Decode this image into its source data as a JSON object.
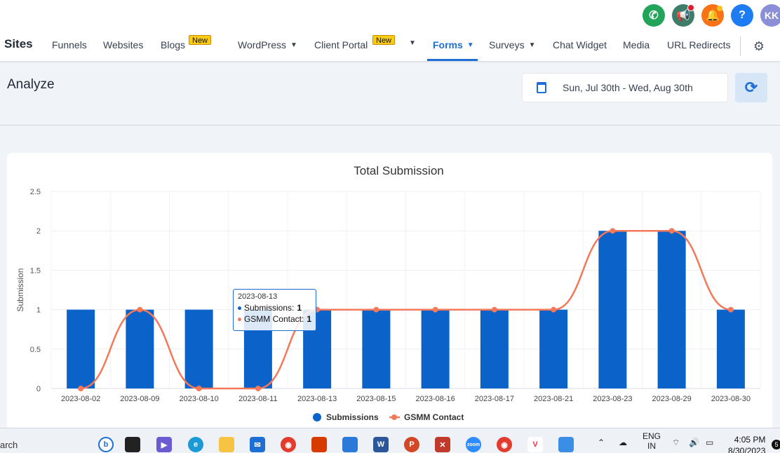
{
  "header_icons": {
    "phone": "phone-icon",
    "megaphone": "megaphone-icon",
    "bell": "bell-icon",
    "help": "help-icon",
    "avatar_initials": "KK"
  },
  "nav": {
    "brand": "Sites",
    "items": [
      {
        "label": "Funnels"
      },
      {
        "label": "Websites"
      },
      {
        "label": "Blogs",
        "badge": "New"
      },
      {
        "label": "WordPress"
      },
      {
        "label": "Client Portal",
        "badge": "New"
      },
      {
        "label": "Forms",
        "active": true
      },
      {
        "label": "Surveys"
      },
      {
        "label": "Chat Widget"
      },
      {
        "label": "Media"
      },
      {
        "label": "URL Redirects"
      }
    ]
  },
  "page": {
    "title": "Analyze",
    "date_range": "Sun, Jul 30th - Wed, Aug 30th"
  },
  "tooltip": {
    "date": "2023-08-13",
    "submissions_label": "Submissions:",
    "submissions_value": "1",
    "contact_label": "GSMM Contact:",
    "contact_value": "1"
  },
  "chart_data": {
    "type": "bar",
    "title": "Total Submission",
    "ylabel": "Submission",
    "xlabel": "",
    "ylim": [
      0,
      2.5
    ],
    "yticks": [
      "0",
      "0.5",
      "1",
      "1.5",
      "2",
      "2.5"
    ],
    "categories": [
      "2023-08-02",
      "2023-08-09",
      "2023-08-10",
      "2023-08-11",
      "2023-08-13",
      "2023-08-15",
      "2023-08-16",
      "2023-08-17",
      "2023-08-21",
      "2023-08-23",
      "2023-08-29",
      "2023-08-30"
    ],
    "series": [
      {
        "name": "Submissions",
        "type": "bar",
        "color": "#0b63c9",
        "values": [
          1,
          1,
          1,
          1,
          1,
          1,
          1,
          1,
          1,
          2,
          2,
          1
        ]
      },
      {
        "name": "GSMM Contact",
        "type": "line",
        "color": "#f4785a",
        "values": [
          0,
          1,
          0,
          0,
          1,
          1,
          1,
          1,
          1,
          2,
          2,
          1
        ]
      }
    ],
    "legend_position": "bottom",
    "grid": true
  },
  "taskbar": {
    "search_text": "arch",
    "lang_line1": "ENG",
    "lang_line2": "IN",
    "time": "4:05 PM",
    "date": "8/30/2023",
    "notification_count": "5"
  }
}
